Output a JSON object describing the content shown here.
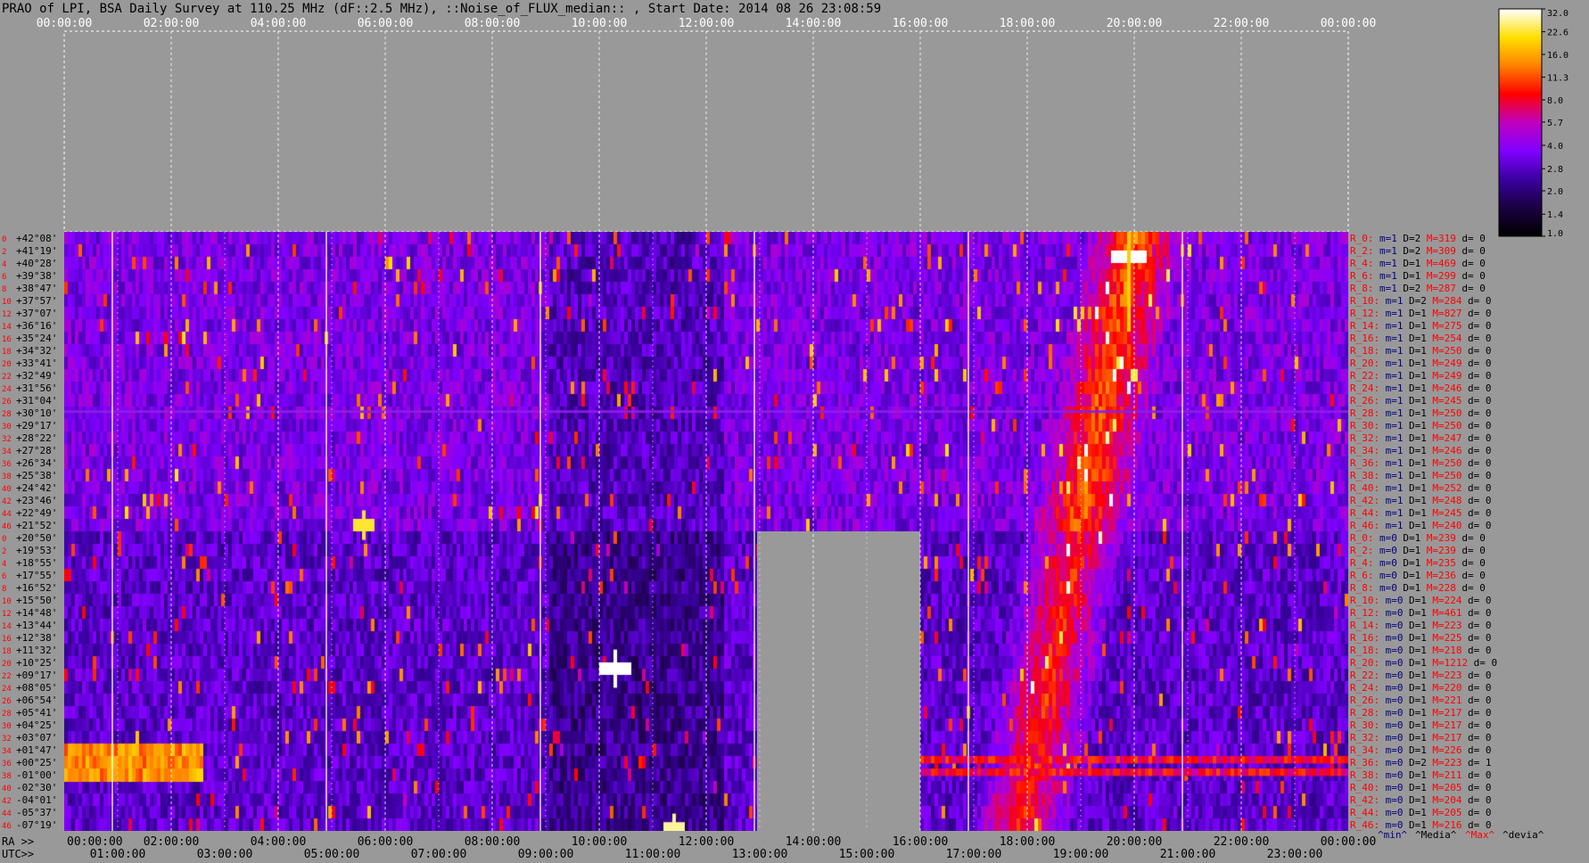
{
  "title": "PRAO of LPI, BSA Daily Survey at 110.25 MHz (dF::2.5 MHz), ::Noise_of_FLUX_median:: , Start Date: 2014 08 26 23:08:59",
  "chart_data": {
    "type": "heatmap",
    "top_axis_ticks": [
      "00:00:00",
      "02:00:00",
      "04:00:00",
      "06:00:00",
      "08:00:00",
      "10:00:00",
      "12:00:00",
      "14:00:00",
      "16:00:00",
      "18:00:00",
      "20:00:00",
      "22:00:00",
      "00:00:00"
    ],
    "bottom_ra_label": "RA >>",
    "bottom_ra_ticks": [
      "00:00:00",
      "02:00:00",
      "04:00:00",
      "06:00:00",
      "08:00:00",
      "10:00:00",
      "12:00:00",
      "14:00:00",
      "16:00:00",
      "18:00:00",
      "20:00:00",
      "22:00:00",
      "00:00:00"
    ],
    "bottom_utc_label": "UTC>>",
    "bottom_utc_ticks": [
      "01:00:00",
      "03:00:00",
      "05:00:00",
      "07:00:00",
      "09:00:00",
      "11:00:00",
      "13:00:00",
      "15:00:00",
      "17:00:00",
      "19:00:00",
      "21:00:00",
      "23:00:00"
    ],
    "declinations": [
      "+42°08'",
      "+41°19'",
      "+40°28'",
      "+39°38'",
      "+38°47'",
      "+37°57'",
      "+37°07'",
      "+36°16'",
      "+35°24'",
      "+34°32'",
      "+33°41'",
      "+32°49'",
      "+31°56'",
      "+31°04'",
      "+30°10'",
      "+29°17'",
      "+28°22'",
      "+27°28'",
      "+26°34'",
      "+25°38'",
      "+24°42'",
      "+23°46'",
      "+22°49'",
      "+21°52'",
      "+20°50'",
      "+19°53'",
      "+18°55'",
      "+17°55'",
      "+16°52'",
      "+15°50'",
      "+14°48'",
      "+13°44'",
      "+12°38'",
      "+11°32'",
      "+10°25'",
      "+09°17'",
      "+08°05'",
      "+06°54'",
      "+05°41'",
      "+04°25'",
      "+03°07'",
      "+01°47'",
      "+00°25'",
      "-01°00'",
      "-02°30'",
      "-04°01'",
      "-05°37'",
      "-07°19'"
    ],
    "beam_row_numbers": [
      "0",
      "2",
      "4",
      "6",
      "8",
      "10",
      "12",
      "14",
      "16",
      "18",
      "20",
      "22",
      "24",
      "26",
      "28",
      "30",
      "32",
      "34",
      "36",
      "38",
      "40",
      "42",
      "44",
      "46",
      "0",
      "2",
      "4",
      "6",
      "8",
      "10",
      "12",
      "14",
      "16",
      "18",
      "20",
      "22",
      "24",
      "26",
      "28",
      "30",
      "32",
      "34",
      "36",
      "38",
      "40",
      "42",
      "44",
      "46"
    ],
    "right_stats": [
      {
        "R": "R_0:",
        "m": "m=1",
        "D": "D=2",
        "M": "M=319",
        "d": "d= 0"
      },
      {
        "R": "R_2:",
        "m": "m=1",
        "D": "D=2",
        "M": "M=309",
        "d": "d= 0"
      },
      {
        "R": "R_4:",
        "m": "m=1",
        "D": "D=1",
        "M": "M=469",
        "d": "d= 0"
      },
      {
        "R": "R_6:",
        "m": "m=1",
        "D": "D=1",
        "M": "M=299",
        "d": "d= 0"
      },
      {
        "R": "R_8:",
        "m": "m=1",
        "D": "D=2",
        "M": "M=287",
        "d": "d= 0"
      },
      {
        "R": "R_10:",
        "m": "m=1",
        "D": "D=2",
        "M": "M=284",
        "d": "d= 0"
      },
      {
        "R": "R_12:",
        "m": "m=1",
        "D": "D=1",
        "M": "M=827",
        "d": "d= 0"
      },
      {
        "R": "R_14:",
        "m": "m=1",
        "D": "D=1",
        "M": "M=275",
        "d": "d= 0"
      },
      {
        "R": "R_16:",
        "m": "m=1",
        "D": "D=1",
        "M": "M=254",
        "d": "d= 0"
      },
      {
        "R": "R_18:",
        "m": "m=1",
        "D": "D=1",
        "M": "M=250",
        "d": "d= 0"
      },
      {
        "R": "R_20:",
        "m": "m=1",
        "D": "D=1",
        "M": "M=249",
        "d": "d= 0"
      },
      {
        "R": "R_22:",
        "m": "m=1",
        "D": "D=1",
        "M": "M=249",
        "d": "d= 0"
      },
      {
        "R": "R_24:",
        "m": "m=1",
        "D": "D=1",
        "M": "M=246",
        "d": "d= 0"
      },
      {
        "R": "R_26:",
        "m": "m=1",
        "D": "D=1",
        "M": "M=245",
        "d": "d= 0"
      },
      {
        "R": "R_28:",
        "m": "m=1",
        "D": "D=1",
        "M": "M=250",
        "d": "d= 0"
      },
      {
        "R": "R_30:",
        "m": "m=1",
        "D": "D=1",
        "M": "M=250",
        "d": "d= 0"
      },
      {
        "R": "R_32:",
        "m": "m=1",
        "D": "D=1",
        "M": "M=247",
        "d": "d= 0"
      },
      {
        "R": "R_34:",
        "m": "m=1",
        "D": "D=1",
        "M": "M=246",
        "d": "d= 0"
      },
      {
        "R": "R_36:",
        "m": "m=1",
        "D": "D=1",
        "M": "M=250",
        "d": "d= 0"
      },
      {
        "R": "R_38:",
        "m": "m=1",
        "D": "D=1",
        "M": "M=250",
        "d": "d= 0"
      },
      {
        "R": "R_40:",
        "m": "m=1",
        "D": "D=1",
        "M": "M=252",
        "d": "d= 0"
      },
      {
        "R": "R_42:",
        "m": "m=1",
        "D": "D=1",
        "M": "M=248",
        "d": "d= 0"
      },
      {
        "R": "R_44:",
        "m": "m=1",
        "D": "D=1",
        "M": "M=245",
        "d": "d= 0"
      },
      {
        "R": "R_46:",
        "m": "m=1",
        "D": "D=1",
        "M": "M=240",
        "d": "d= 0"
      },
      {
        "R": "R_0:",
        "m": "m=0",
        "D": "D=1",
        "M": "M=239",
        "d": "d= 0"
      },
      {
        "R": "R_2:",
        "m": "m=0",
        "D": "D=1",
        "M": "M=239",
        "d": "d= 0"
      },
      {
        "R": "R_4:",
        "m": "m=0",
        "D": "D=1",
        "M": "M=235",
        "d": "d= 0"
      },
      {
        "R": "R_6:",
        "m": "m=0",
        "D": "D=1",
        "M": "M=236",
        "d": "d= 0"
      },
      {
        "R": "R_8:",
        "m": "m=0",
        "D": "D=1",
        "M": "M=228",
        "d": "d= 0"
      },
      {
        "R": "R_10:",
        "m": "m=0",
        "D": "D=1",
        "M": "M=224",
        "d": "d= 0"
      },
      {
        "R": "R_12:",
        "m": "m=0",
        "D": "D=1",
        "M": "M=461",
        "d": "d= 0"
      },
      {
        "R": "R_14:",
        "m": "m=0",
        "D": "D=1",
        "M": "M=223",
        "d": "d= 0"
      },
      {
        "R": "R_16:",
        "m": "m=0",
        "D": "D=1",
        "M": "M=225",
        "d": "d= 0"
      },
      {
        "R": "R_18:",
        "m": "m=0",
        "D": "D=1",
        "M": "M=218",
        "d": "d= 0"
      },
      {
        "R": "R_20:",
        "m": "m=0",
        "D": "D=1",
        "M": "M=1212",
        "d": "d= 0"
      },
      {
        "R": "R_22:",
        "m": "m=0",
        "D": "D=1",
        "M": "M=223",
        "d": "d= 0"
      },
      {
        "R": "R_24:",
        "m": "m=0",
        "D": "D=1",
        "M": "M=220",
        "d": "d= 0"
      },
      {
        "R": "R_26:",
        "m": "m=0",
        "D": "D=1",
        "M": "M=221",
        "d": "d= 0"
      },
      {
        "R": "R_28:",
        "m": "m=0",
        "D": "D=1",
        "M": "M=217",
        "d": "d= 0"
      },
      {
        "R": "R_30:",
        "m": "m=0",
        "D": "D=1",
        "M": "M=217",
        "d": "d= 0"
      },
      {
        "R": "R_32:",
        "m": "m=0",
        "D": "D=1",
        "M": "M=217",
        "d": "d= 0"
      },
      {
        "R": "R_34:",
        "m": "m=0",
        "D": "D=1",
        "M": "M=226",
        "d": "d= 0"
      },
      {
        "R": "R_36:",
        "m": "m=0",
        "D": "D=2",
        "M": "M=223",
        "d": "d= 1"
      },
      {
        "R": "R_38:",
        "m": "m=0",
        "D": "D=1",
        "M": "M=211",
        "d": "d= 0"
      },
      {
        "R": "R_40:",
        "m": "m=0",
        "D": "D=1",
        "M": "M=205",
        "d": "d= 0"
      },
      {
        "R": "R_42:",
        "m": "m=0",
        "D": "D=1",
        "M": "M=204",
        "d": "d= 0"
      },
      {
        "R": "R_44:",
        "m": "m=0",
        "D": "D=1",
        "M": "M=205",
        "d": "d= 0"
      },
      {
        "R": "R_46:",
        "m": "m=0",
        "D": "D=1",
        "M": "M=216",
        "d": "d= 0"
      }
    ],
    "stats_footer": [
      "^min^",
      "^Media^",
      "^Max^",
      "^devia^"
    ],
    "colorbar_ticks": [
      "32.0",
      "22.6",
      "16.0",
      "11.3",
      "8.0",
      "5.7",
      "4.0",
      "2.8",
      "2.0",
      "1.4",
      "1.0"
    ],
    "colorbar_range": [
      1.0,
      32.0
    ],
    "colorbar_scale": "log",
    "data_gap_region": {
      "ra_start": "13:00:00",
      "ra_end": "16:00:00",
      "dec_from": "+20°50'",
      "dec_to": "-07°19'"
    },
    "empty_region": {
      "dec_above": "+42°08'"
    },
    "colors": {
      "background": "#999999",
      "title": "#000000",
      "top_ticks": "#ffffff",
      "grid": "#ffffff",
      "dec_labels": "#000000",
      "row_numbers": "#ff0000",
      "stat_R": "#ff0000",
      "stat_m": "#000080",
      "stat_D": "#000000",
      "stat_M": "#ff0000",
      "stat_d": "#000000",
      "bottom_ticks": "#000000",
      "colormap": [
        "#000000",
        "#1a0040",
        "#3a00a0",
        "#8000ff",
        "#c000c0",
        "#ff0000",
        "#ff8000",
        "#ffe000",
        "#ffffff"
      ]
    }
  }
}
